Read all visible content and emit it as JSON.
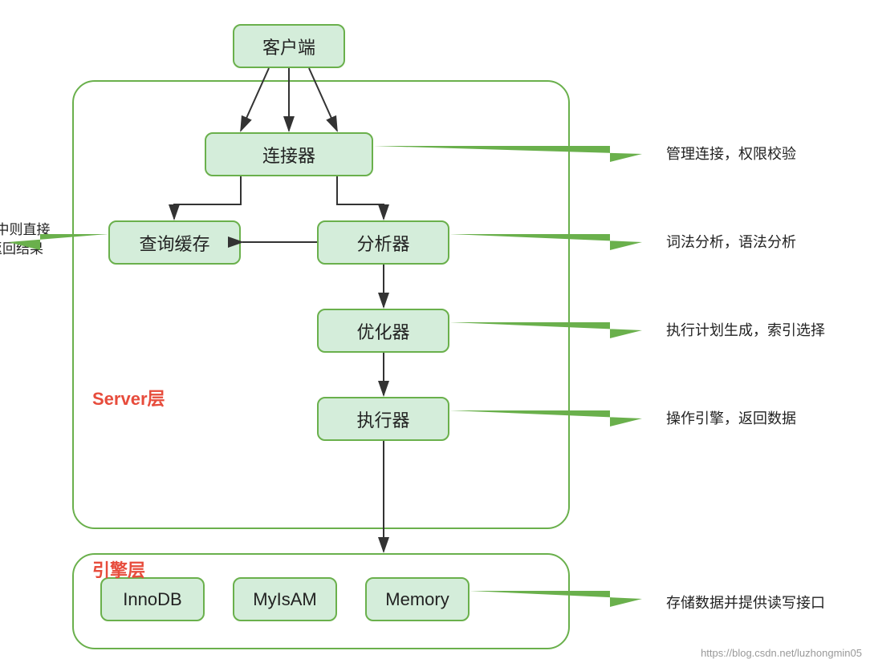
{
  "nodes": {
    "client": "客户端",
    "connector": "连接器",
    "query_cache": "查询缓存",
    "analyzer": "分析器",
    "optimizer": "优化器",
    "executor": "执行器",
    "innodb": "InnoDB",
    "myisam": "MyIsAM",
    "memory": "Memory"
  },
  "labels": {
    "server_layer": "Server层",
    "engine_layer": "引擎层"
  },
  "annotations": {
    "connector": "管理连接，权限校验",
    "analyzer": "词法分析，语法分析",
    "optimizer": "执行计划生成，索引选择",
    "executor": "操作引擎，返回数据",
    "engine": "存储数据并提供读写接口",
    "cache_left_line1": "命中则直接",
    "cache_left_line2": "返回结果"
  },
  "watermark": "https://blog.csdn.net/luzhongmin05"
}
